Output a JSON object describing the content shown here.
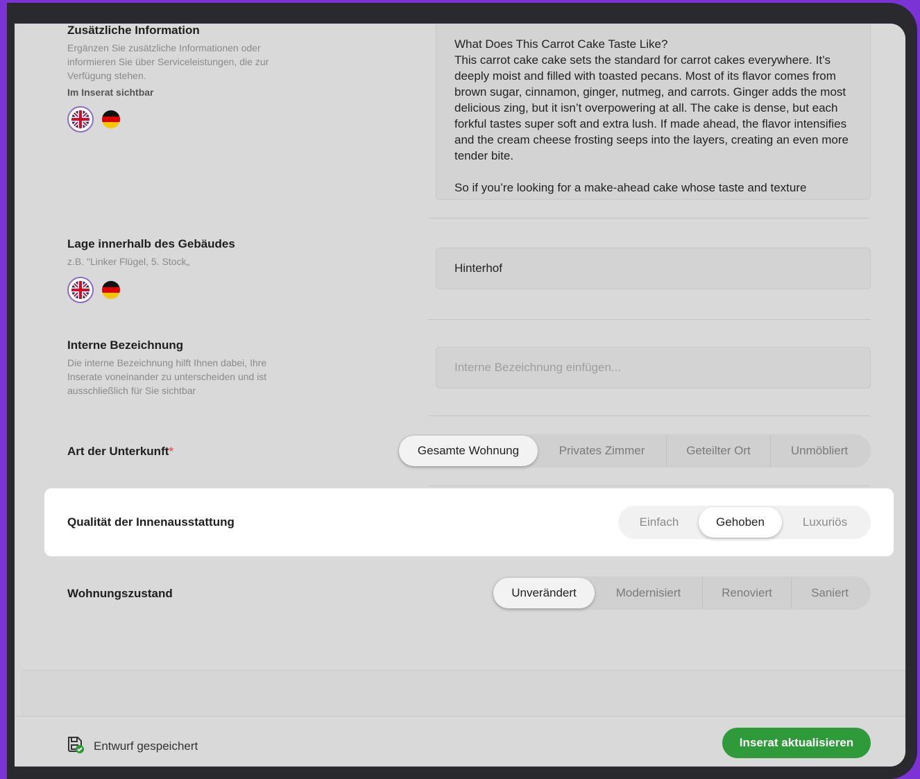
{
  "additional_info": {
    "title": "Zusätzliche Information",
    "description": "Ergänzen Sie zusätzliche Informationen oder informieren Sie über Serviceleistungen, die zur Verfügung stehen.",
    "visibility_note": "Im Inserat sichtbar",
    "value": "What Does This Carrot Cake Taste Like?\nThis carrot cake cake sets the standard for carrot cakes everywhere. It’s deeply moist and filled with toasted pecans. Most of its flavor comes from brown sugar, cinnamon, ginger, nutmeg, and carrots. Ginger adds the most delicious zing, but it isn’t overpowering at all. The cake is dense, but each forkful tastes super soft and extra lush. If made ahead, the flavor intensifies and the cream cheese frosting seeps into the layers, creating an even more tender bite.\n\nSo if you’re looking for a make-ahead cake whose taste and texture"
  },
  "location": {
    "title": "Lage innerhalb des Gebäudes",
    "hint": "z.B. \"Linker Flügel, 5. Stock„",
    "value": "Hinterhof"
  },
  "internal_name": {
    "title": "Interne Bezeichnung",
    "description": "Die interne Bezeichnung hilft Ihnen dabei, Ihre Inserate voneinander zu unterscheiden und ist ausschließlich für Sie sichtbar",
    "placeholder": "Interne Bezeichnung einfügen..."
  },
  "accommodation_type": {
    "label": "Art der Unterkunft",
    "required_mark": "*",
    "options": [
      "Gesamte Wohnung",
      "Privates Zimmer",
      "Geteilter Ort",
      "Unmöbliert"
    ],
    "selected": "Gesamte Wohnung"
  },
  "interior_quality": {
    "label": "Qualität der Innenausstattung",
    "options": [
      "Einfach",
      "Gehoben",
      "Luxuriös"
    ],
    "selected": "Gehoben"
  },
  "apartment_condition": {
    "label": "Wohnungszustand",
    "options": [
      "Unverändert",
      "Modernisiert",
      "Renoviert",
      "Saniert"
    ],
    "selected": "Unverändert"
  },
  "language_flags": [
    "uk-flag-icon",
    "germany-flag-icon"
  ],
  "footer": {
    "draft_icon": "save-draft-icon",
    "draft_status": "Entwurf gespeichert",
    "submit_label": "Inserat aktualisieren"
  },
  "colors": {
    "accent_purple": "#7b33d6",
    "primary_green": "#2f9a3a"
  }
}
